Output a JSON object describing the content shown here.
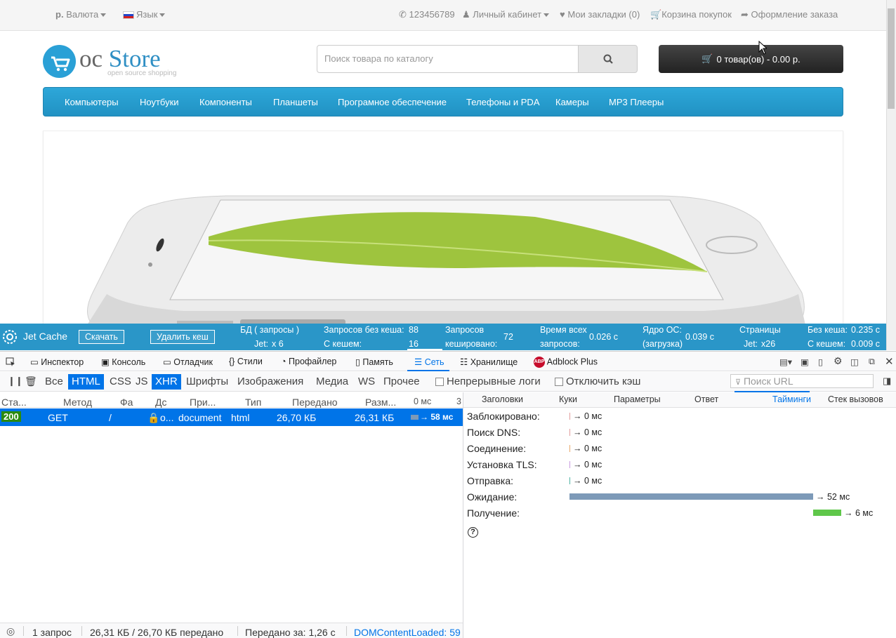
{
  "topbar": {
    "currency_symbol": "р.",
    "currency": "Валюта",
    "language": "Язык",
    "phone": "123456789",
    "account": "Личный кабинет",
    "wishlist": "Мои закладки (0)",
    "cart": "Корзина покупок",
    "checkout": "Оформление заказа"
  },
  "header": {
    "logo_oc": "oc",
    "logo_store": "Store",
    "logo_sub": "open source shopping",
    "search_placeholder": "Поиск товара по каталогу",
    "cart_button": "0 товар(ов) - 0.00 р."
  },
  "menu": [
    "Компьютеры",
    "Ноутбуки",
    "Компоненты",
    "Планшеты",
    "Програмное обеспечение",
    "Телефоны и PDA",
    "Камеры",
    "MP3 Плееры"
  ],
  "jetcache": {
    "title": "Jet Cache",
    "download": "Скачать",
    "clear": "Удалить кеш",
    "db_label": "БД ( запросы )",
    "jet_label": "Jet:",
    "jet_val": "x 6",
    "no_cache_label": "Запросов без кеша:",
    "no_cache_val": "88",
    "with_cache_label": "С кешем:",
    "with_cache_val": "16",
    "cached_label1": "Запросов",
    "cached_label2": "кешировано:",
    "cached_val": "72",
    "time_label1": "Время всех",
    "time_label2": "запросов:",
    "time_val": "0.026 с",
    "core_label1": "Ядро ОС:",
    "core_label2": "(загрузка)",
    "core_val": "0.039 с",
    "pages_label": "Страницы",
    "pages_jet_label": "Jet:",
    "pages_jet_val": "x26",
    "nc_label": "Без кеша:",
    "nc_val": "0.235 с",
    "wc_label": "С кешем:",
    "wc_val": "0.009 с"
  },
  "devtools": {
    "tools": [
      "Инспектор",
      "Консоль",
      "Отладчик",
      "Стили",
      "Профайлер",
      "Память",
      "Сеть",
      "Хранилище",
      "Adblock Plus"
    ],
    "filters": [
      "Все",
      "HTML",
      "CSS",
      "JS",
      "XHR",
      "Шрифты",
      "Изображения",
      "Медиа",
      "WS",
      "Прочее"
    ],
    "persist_logs": "Непрерывные логи",
    "disable_cache": "Отключить кэш",
    "url_filter_placeholder": "Поиск URL",
    "columns": [
      "Ста...",
      "Метод",
      "Фа",
      "Дс",
      "При...",
      "Тип",
      "Передано",
      "Разм...",
      "0 мс",
      "3"
    ],
    "request": {
      "status": "200",
      "method": "GET",
      "file": "/",
      "domain": "o...",
      "cause": "document",
      "type": "html",
      "transferred": "26,70 КБ",
      "size": "26,31 КБ",
      "timing": "→ 58 мс"
    },
    "side_tabs": [
      "Заголовки",
      "Куки",
      "Параметры",
      "Ответ",
      "Тайминги",
      "Стек вызовов"
    ],
    "timings": [
      {
        "label": "Заблокировано:",
        "value": "→ 0 мс"
      },
      {
        "label": "Поиск DNS:",
        "value": "→ 0 мс"
      },
      {
        "label": "Соединение:",
        "value": "→ 0 мс"
      },
      {
        "label": "Установка TLS:",
        "value": "→ 0 мс"
      },
      {
        "label": "Отправка:",
        "value": "→ 0 мс"
      },
      {
        "label": "Ожидание:",
        "value": "→ 52 мс"
      },
      {
        "label": "Получение:",
        "value": "→ 6 мс"
      }
    ],
    "status_bar": {
      "requests": "1 запрос",
      "transferred": "26,31 КБ / 26,70 КБ передано",
      "finish": "Передано за: 1,26 с",
      "dom": "DOMContentLoaded: 59"
    }
  },
  "colors": {
    "accent": "#2aa0d6",
    "devtools_blue": "#0074e8",
    "wait_bar": "#7d9ab8",
    "receive_bar": "#5fc74a"
  }
}
